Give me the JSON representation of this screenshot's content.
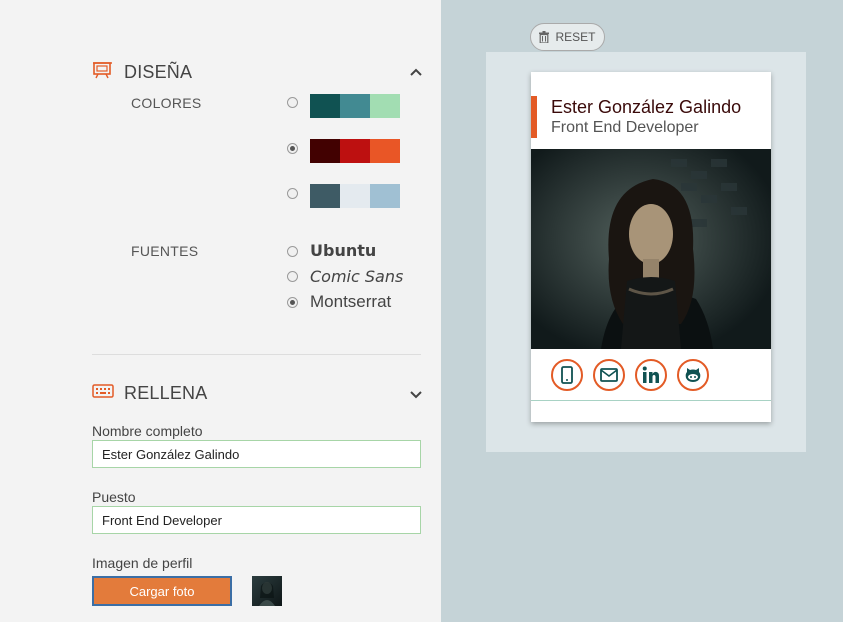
{
  "design": {
    "title": "DISEÑA",
    "colors_label": "COLORES",
    "fonts_label": "FUENTES",
    "palettes": [
      {
        "colors": [
          "#105252",
          "#428a92",
          "#a2ddb2"
        ],
        "selected": false
      },
      {
        "colors": [
          "#420101",
          "#bd1010",
          "#e95626"
        ],
        "selected": true
      },
      {
        "colors": [
          "#3e5b65",
          "#e4eaef",
          "#a0c0d3"
        ],
        "selected": false
      }
    ],
    "fonts": [
      {
        "label": "Ubuntu",
        "selected": false
      },
      {
        "label": "Comic Sans",
        "selected": false
      },
      {
        "label": "Montserrat",
        "selected": true
      }
    ]
  },
  "fill": {
    "title": "RELLENA",
    "name_label": "Nombre completo",
    "name_value": "Ester González Galindo",
    "job_label": "Puesto",
    "job_value": "Front End Developer",
    "image_label": "Imagen de perfil",
    "upload_label": "Cargar foto"
  },
  "preview": {
    "reset_label": "RESET",
    "card_name": "Ester González Galindo",
    "card_job": "Front End Developer",
    "social_icons": [
      "phone-icon",
      "mail-icon",
      "linkedin-icon",
      "github-icon"
    ]
  },
  "colors": {
    "accent": "#e35b26",
    "panel_left": "#f3f3f3",
    "panel_right": "#c5d3d7",
    "input_border": "#a7d5a7"
  }
}
